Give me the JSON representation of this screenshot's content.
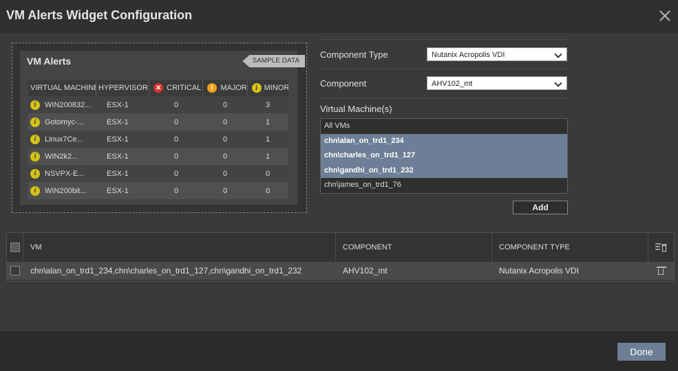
{
  "dialog": {
    "title": "VM Alerts Widget Configuration"
  },
  "preview": {
    "widget_title": "VM Alerts",
    "sample_label": "SAMPLE DATA",
    "columns": [
      "VIRTUAL MACHINE",
      "HYPERVISOR",
      "CRITICAL",
      "MAJOR",
      "MINOR"
    ],
    "rows": [
      {
        "vm": "WIN200832...",
        "hypervisor": "ESX-1",
        "critical": "0",
        "major": "0",
        "minor": "3"
      },
      {
        "vm": "Gotomyc-...",
        "hypervisor": "ESX-1",
        "critical": "0",
        "major": "0",
        "minor": "1"
      },
      {
        "vm": "Linux7Ce...",
        "hypervisor": "ESX-1",
        "critical": "0",
        "major": "0",
        "minor": "1"
      },
      {
        "vm": "WIN2k2...",
        "hypervisor": "ESX-1",
        "critical": "0",
        "major": "0",
        "minor": "1"
      },
      {
        "vm": "NSVPX-E...",
        "hypervisor": "ESX-1",
        "critical": "0",
        "major": "0",
        "minor": "0"
      },
      {
        "vm": "WIN200bit...",
        "hypervisor": "ESX-1",
        "critical": "0",
        "major": "0",
        "minor": "0"
      }
    ]
  },
  "form": {
    "component_type_label": "Component Type",
    "component_type_value": "Nutanix Acropolis VDI",
    "component_label": "Component",
    "component_value": "AHV102_mt",
    "vms_label": "Virtual Machine(s)",
    "vms": [
      {
        "name": "All VMs",
        "selected": false
      },
      {
        "name": "chn\\alan_on_trd1_234",
        "selected": true
      },
      {
        "name": "chn\\charles_on_trd1_127",
        "selected": true
      },
      {
        "name": "chn\\gandhi_on_trd1_232",
        "selected": true
      },
      {
        "name": "chn\\james_on_trd1_76",
        "selected": false
      }
    ],
    "add_label": "Add"
  },
  "grid": {
    "headers": {
      "vm": "VM",
      "component": "COMPONENT",
      "component_type": "COMPONENT TYPE"
    },
    "rows": [
      {
        "vm": "chn\\alan_on_trd1_234,chn\\charles_on_trd1_127,chn\\gandhi_on_trd1_232",
        "component": "AHV102_mt",
        "component_type": "Nutanix Acropolis VDI"
      }
    ]
  },
  "footer": {
    "done_label": "Done"
  },
  "colors": {
    "accent": "#6d7f96",
    "critical": "#d32f2f",
    "major": "#f0a020",
    "minor": "#d5c217"
  }
}
